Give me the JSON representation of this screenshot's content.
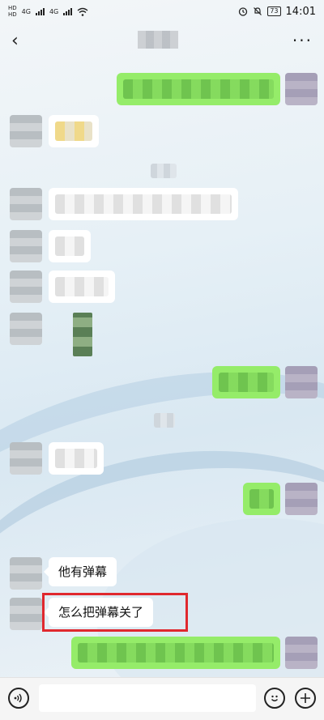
{
  "status_bar": {
    "hd_top": "HD",
    "hd_bottom": "HD",
    "net_1": "4G",
    "net_2": "4G",
    "battery": "73",
    "time": "14:01"
  },
  "nav": {
    "back_icon": "chevron-left-icon",
    "more_icon": "more-icon",
    "more_label": "···"
  },
  "messages": [
    {
      "id": "m1",
      "side": "right",
      "type": "blurred"
    },
    {
      "id": "m2",
      "side": "left",
      "type": "blurred"
    },
    {
      "id": "m3",
      "side": "center",
      "type": "blurred-system"
    },
    {
      "id": "m4",
      "side": "left",
      "type": "blurred"
    },
    {
      "id": "m5",
      "side": "left",
      "type": "blurred"
    },
    {
      "id": "m6",
      "side": "left",
      "type": "blurred"
    },
    {
      "id": "m7",
      "side": "left",
      "type": "blurred-image"
    },
    {
      "id": "m8",
      "side": "right",
      "type": "blurred"
    },
    {
      "id": "m9",
      "side": "center",
      "type": "blurred-system"
    },
    {
      "id": "m10",
      "side": "left",
      "type": "blurred"
    },
    {
      "id": "m11",
      "side": "right",
      "type": "blurred"
    },
    {
      "id": "m12",
      "side": "left",
      "type": "text",
      "text": "他有弹幕"
    },
    {
      "id": "m13",
      "side": "left",
      "type": "text",
      "text": "怎么把弹幕关了",
      "highlighted": true
    },
    {
      "id": "m14",
      "side": "right",
      "type": "blurred"
    }
  ],
  "input_bar": {
    "voice_icon": "voice-icon",
    "emoji_icon": "emoji-icon",
    "plus_icon": "plus-icon",
    "text_value": ""
  },
  "colors": {
    "sent_bubble": "#95ec69",
    "received_bubble": "#ffffff",
    "highlight_border": "#e0282e"
  }
}
